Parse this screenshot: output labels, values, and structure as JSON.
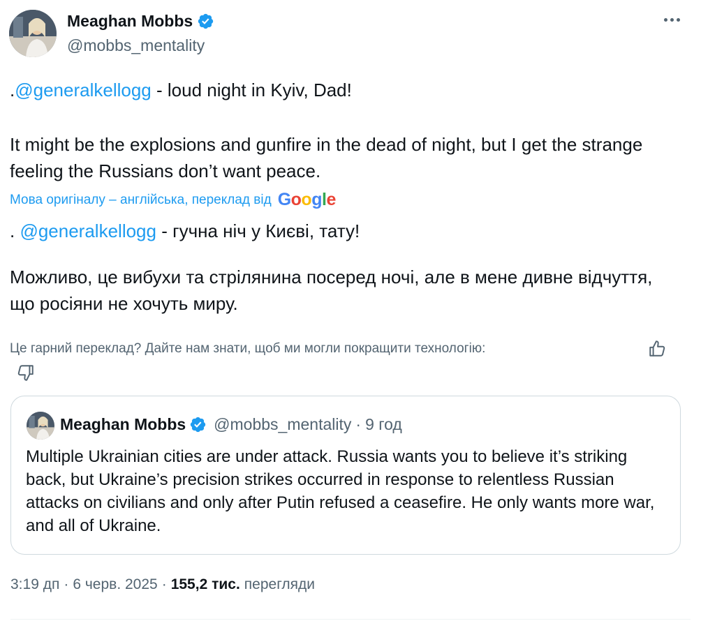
{
  "author": {
    "display_name": "Meaghan Mobbs",
    "handle": "@mobbs_mentality"
  },
  "tweet": {
    "line1_prefix": ".",
    "line1_mention": "@generalkellogg",
    "line1_rest": " - loud night in Kyiv, Dad!",
    "line2": "It might be the explosions and gunfire in the dead of night, but I get the strange feeling the Russians don’t want peace."
  },
  "translation": {
    "notice": "Мова оригіналу – англійська, переклад від",
    "provider_letters": [
      "G",
      "o",
      "o",
      "g",
      "l",
      "e"
    ],
    "line1_prefix": ". ",
    "line1_mention": "@generalkellogg",
    "line1_rest": " - гучна ніч у Києві, тату!",
    "line2": "Можливо, це вибухи та стрілянина посеред ночі, але в мене дивне відчуття, що росіяни не хочуть миру.",
    "feedback_prompt": "Це гарний переклад? Дайте нам знати, щоб ми могли покращити технологію:"
  },
  "quote": {
    "display_name": "Meaghan Mobbs",
    "handle": "@mobbs_mentality",
    "dot": "·",
    "time": "9 год",
    "text": "Multiple Ukrainian cities are under attack. Russia wants you to believe it’s striking back, but Ukraine’s precision strikes occurred in response to relentless Russian attacks on civilians and only after Putin refused a ceasefire. He only wants more war, and all of Ukraine."
  },
  "meta": {
    "time": "3:19 дп",
    "sep": "·",
    "date": "6 черв. 2025",
    "views_count": "155,2 тис.",
    "views_label": "перегляди"
  },
  "colors": {
    "accent": "#1d9bf0",
    "text": "#0f1419",
    "secondary": "#536471",
    "border": "#cfd9de"
  },
  "icons": {
    "verified": "verified-badge-icon",
    "more": "more-options-icon",
    "thumb_up": "thumbs-up-icon",
    "thumb_down": "thumbs-down-icon"
  }
}
